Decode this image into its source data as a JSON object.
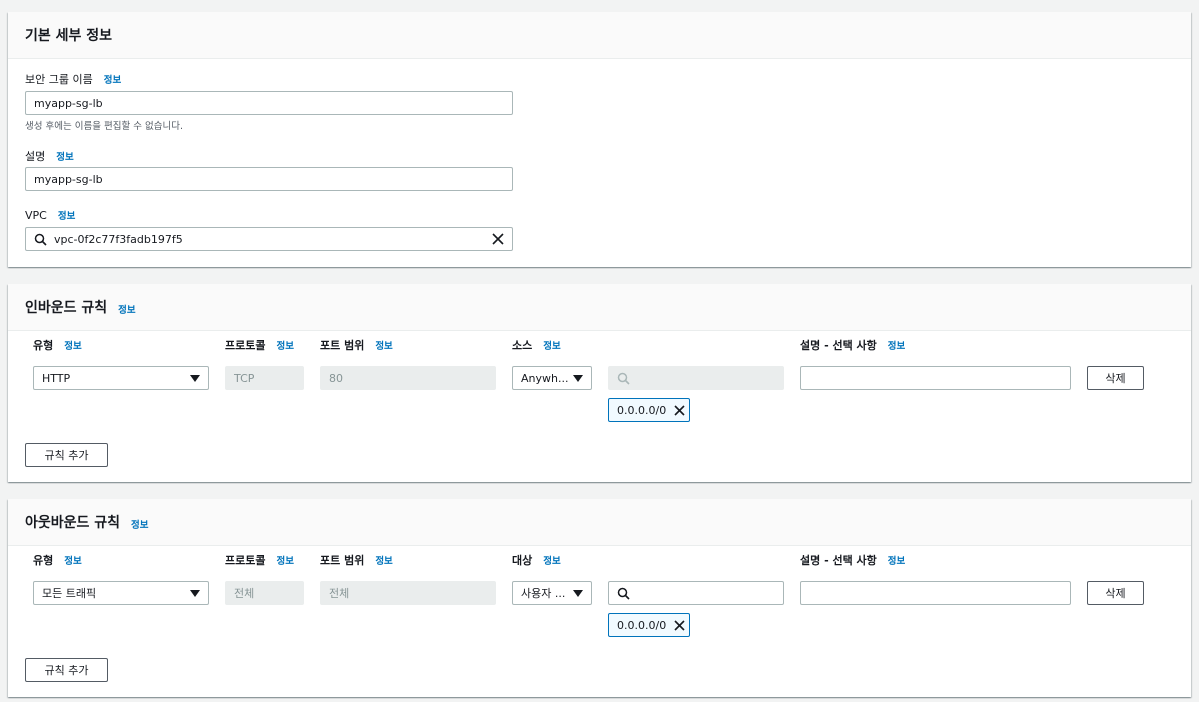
{
  "basic": {
    "title": "기본 세부 정보",
    "sg_name_label": "보안 그룹 이름",
    "sg_name_info": "정보",
    "sg_name_value": "myapp-sg-lb",
    "sg_name_hint": "생성 후에는 이름을 편집할 수 없습니다.",
    "desc_label": "설명",
    "desc_info": "정보",
    "desc_value": "myapp-sg-lb",
    "vpc_label": "VPC",
    "vpc_info": "정보",
    "vpc_value": "vpc-0f2c77f3fadb197f5"
  },
  "inbound": {
    "title": "인바운드 규칙",
    "title_info": "정보",
    "col_type": "유형",
    "col_protocol": "프로토콜",
    "col_port": "포트 범위",
    "col_source": "소스",
    "col_desc": "설명 - 선택 사항",
    "info": "정보",
    "rule": {
      "type": "HTTP",
      "protocol": "TCP",
      "port": "80",
      "source": "Anywh...",
      "search_value": "",
      "cidr": "0.0.0.0/0",
      "description": ""
    },
    "delete_label": "삭제",
    "add_rule_label": "규칙 추가"
  },
  "outbound": {
    "title": "아웃바운드 규칙",
    "title_info": "정보",
    "col_type": "유형",
    "col_protocol": "프로토콜",
    "col_port": "포트 범위",
    "col_dest": "대상",
    "col_desc": "설명 - 선택 사항",
    "info": "정보",
    "rule": {
      "type": "모든 트래픽",
      "protocol": "전체",
      "port": "전체",
      "dest": "사용자 ...",
      "search_value": "",
      "cidr": "0.0.0.0/0",
      "description": ""
    },
    "delete_label": "삭제",
    "add_rule_label": "규칙 추가"
  },
  "colors": {
    "link": "#0073bb",
    "token_border": "#0073bb",
    "token_bg": "#f1faff",
    "disabled_bg": "#eaeded"
  }
}
